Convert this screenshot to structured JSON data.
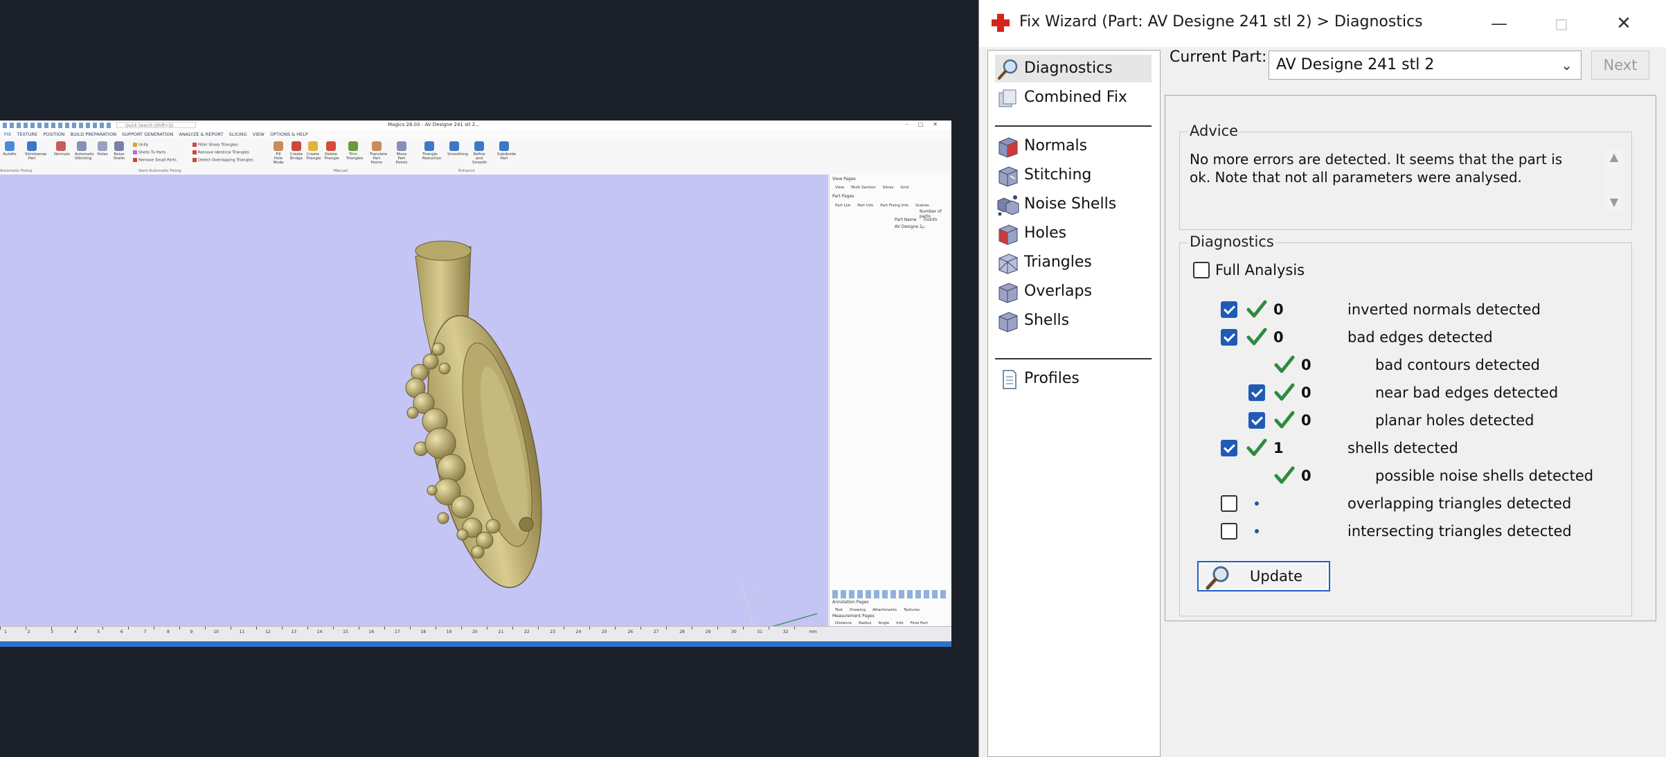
{
  "magics": {
    "title": "Magics 28.03 - AV Designe 241 stl 2...",
    "search_placeholder": "Quick Search (Shift+Q)",
    "menu": [
      "FIX",
      "TEXTURE",
      "POSITION",
      "BUILD PREPARATION",
      "SUPPORT GENERATION",
      "ANALYZE & REPORT",
      "SLICING",
      "VIEW",
      "OPTIONS & HELP"
    ],
    "ribbon": [
      "Autofix",
      "Shrinkwrap Part",
      "Normals",
      "Automatic Stitching",
      "Holes",
      "Noise Shells",
      "Fill Hole Mode",
      "Create Bridge",
      "Create Triangle",
      "Delete Triangle",
      "Trim Triangles",
      "Translate Part Points",
      "Move Part Points",
      "Triangle Reduction",
      "Smoothing",
      "Refine and Smooth",
      "Subdivide Part"
    ],
    "ribbon_small": [
      "Unify",
      "Shells To Parts",
      "Remove Small Parts",
      "Filter Sharp Triangles",
      "Remove Identical Triangles",
      "Detect Overlapping Triangles"
    ],
    "ribbon_groups": [
      "Automatic Fixing",
      "Semi-Automatic Fixing",
      "Manual",
      "Enhance"
    ],
    "right_panel": {
      "view_pages": "View Pages",
      "view_tabs": [
        "View",
        "Multi Section",
        "Slices",
        "Grid"
      ],
      "part_pages": "Part Pages",
      "part_tabs": [
        "Part List",
        "Part Info",
        "Part Fixing Info",
        "Scenes"
      ],
      "number_of_parts": "Number of parts:",
      "part_name_col": "Part Name",
      "fixinfo_col": "FixInfo",
      "part_name": "AV Designe 2...",
      "annotation_pages": "Annotation Pages",
      "annotation_tabs": [
        "Text",
        "Drawing",
        "Attachments",
        "Textures"
      ],
      "measurement_pages": "Measurement Pages",
      "measure_tabs": [
        "Distance",
        "Radius",
        "Angle",
        "Info",
        "Final Part"
      ]
    },
    "ruler": [
      "1",
      "2",
      "3",
      "4",
      "5",
      "6",
      "7",
      "8",
      "9",
      "10",
      "11",
      "12",
      "13",
      "14",
      "15",
      "16",
      "17",
      "18",
      "19",
      "20",
      "21",
      "22",
      "23",
      "24",
      "25",
      "26",
      "27",
      "28",
      "29",
      "30",
      "31",
      "32"
    ],
    "ruler_unit": "mm"
  },
  "wizard": {
    "title": "Fix Wizard (Part: AV Designe 241 stl 2) > Diagnostics",
    "nav": [
      {
        "label": "Diagnostics",
        "icon": "magnifier-icon"
      },
      {
        "label": "Combined Fix",
        "icon": "combined-fix-icon"
      },
      {
        "label": "Normals",
        "icon": "normals-cube-icon"
      },
      {
        "label": "Stitching",
        "icon": "stitching-cube-icon"
      },
      {
        "label": "Noise Shells",
        "icon": "noise-shells-icon"
      },
      {
        "label": "Holes",
        "icon": "holes-cube-icon"
      },
      {
        "label": "Triangles",
        "icon": "triangles-cube-icon"
      },
      {
        "label": "Overlaps",
        "icon": "overlaps-cube-icon"
      },
      {
        "label": "Shells",
        "icon": "shells-cube-icon"
      },
      {
        "label": "Profiles",
        "icon": "profiles-doc-icon"
      }
    ],
    "current_part_label": "Current Part:",
    "current_part_value": "AV Designe 241 stl 2",
    "next_label": "Next",
    "advice_title": "Advice",
    "advice_text": "No more errors are detected. It seems that the part is ok. Note that not all parameters were analysed.",
    "diagnostics_title": "Diagnostics",
    "full_analysis_label": "Full Analysis",
    "full_analysis_checked": false,
    "rows": [
      {
        "count": "0",
        "label": "inverted normals detected",
        "checked": true
      },
      {
        "count": "0",
        "label": "bad edges detected",
        "checked": true
      },
      {
        "count": "0",
        "label": "bad contours detected"
      },
      {
        "count": "0",
        "label": "near bad edges detected",
        "checked": true
      },
      {
        "count": "0",
        "label": "planar holes detected",
        "checked": true
      },
      {
        "count": "1",
        "label": "shells detected",
        "checked": true
      },
      {
        "count": "0",
        "label": "possible noise shells detected"
      },
      {
        "count": "",
        "label": "overlapping triangles detected",
        "checked": false
      },
      {
        "count": "",
        "label": "intersecting triangles detected",
        "checked": false
      }
    ],
    "update_label": "Update"
  }
}
